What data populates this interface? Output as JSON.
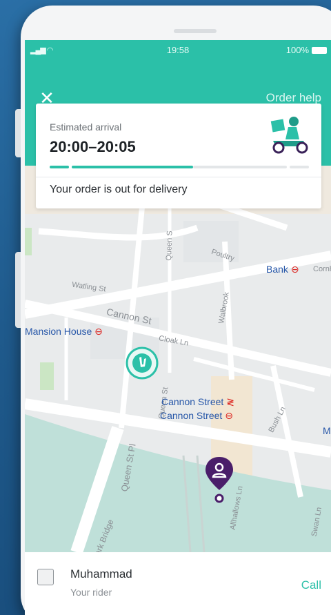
{
  "status_bar": {
    "time": "19:58",
    "battery": "100%"
  },
  "header": {
    "order_help": "Order help",
    "close_symbol": "✕"
  },
  "tracking_card": {
    "eta_label": "Estimated arrival",
    "eta_value": "20:00–20:05",
    "status": "Your order is out for delivery",
    "progress_fraction": 0.55
  },
  "map": {
    "stations": {
      "bank": "Bank",
      "mansion_house": "Mansion House",
      "cannon_street_rail": "Cannon Street",
      "cannon_street_tube": "Cannon Street"
    },
    "streets": {
      "cannon_st": "Cannon St",
      "watling_st": "Watling St",
      "cloak_ln": "Cloak Ln",
      "queen_st_pl": "Queen St Pl",
      "southwark_bridge": "Southwark Bridge",
      "walbrook": "Walbrook",
      "poultry": "Poultry",
      "bush_ln": "Bush Ln",
      "allhallows_ln": "Allhallows Ln",
      "swan_ln": "Swan Ln",
      "queen_st": "Queen St",
      "queen_s": "Queen S",
      "cornhill": "Cornh",
      "edge_m": "M"
    }
  },
  "rider": {
    "name": "Muhammad",
    "role": "Your rider",
    "call_label": "Call"
  },
  "colors": {
    "brand": "#2bc0a8",
    "destination_pin": "#4a1e6a",
    "tube": "#dc241f"
  },
  "icons": {
    "close": "close-icon",
    "scooter": "delivery-scooter-icon",
    "rider_marker": "rider-location-icon",
    "destination": "destination-pin-icon",
    "avatar": "rider-avatar-icon"
  }
}
